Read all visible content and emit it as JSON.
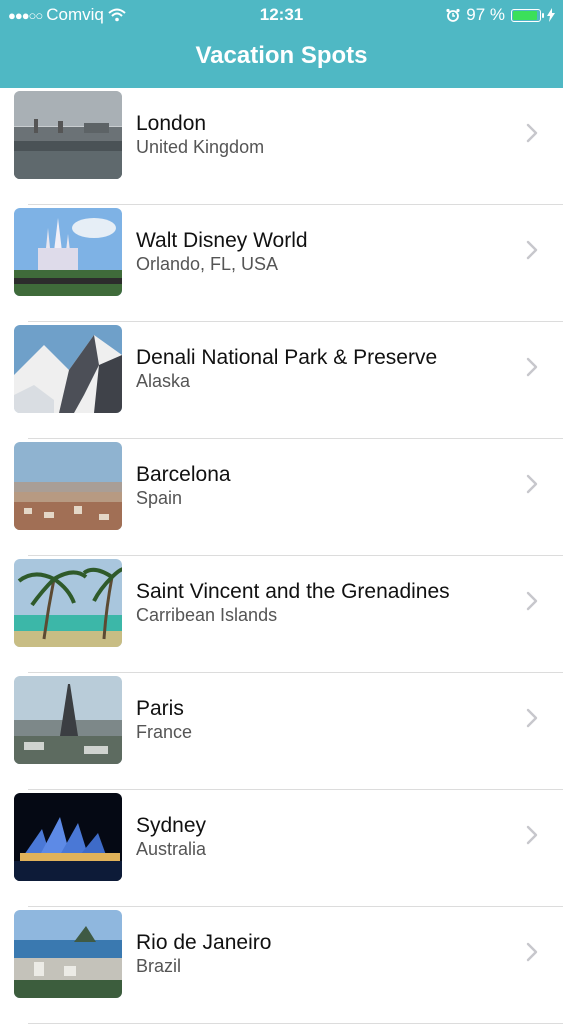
{
  "status_bar": {
    "carrier": "Comviq",
    "time": "12:31",
    "battery_percent": "97 %",
    "battery_level": 0.97
  },
  "nav": {
    "title": "Vacation Spots"
  },
  "colors": {
    "accent": "#4fb8c4"
  },
  "spots": [
    {
      "title": "London",
      "subtitle": "United Kingdom",
      "image": "london-photo"
    },
    {
      "title": "Walt Disney World",
      "subtitle": "Orlando, FL, USA",
      "image": "disney-castle-photo"
    },
    {
      "title": "Denali National Park & Preserve",
      "subtitle": "Alaska",
      "image": "mountains-photo"
    },
    {
      "title": "Barcelona",
      "subtitle": "Spain",
      "image": "city-skyline-photo"
    },
    {
      "title": "Saint Vincent and the Grenadines",
      "subtitle": "Carribean Islands",
      "image": "beach-palms-photo"
    },
    {
      "title": "Paris",
      "subtitle": "France",
      "image": "eiffel-tower-photo"
    },
    {
      "title": "Sydney",
      "subtitle": "Australia",
      "image": "opera-house-photo"
    },
    {
      "title": "Rio de Janeiro",
      "subtitle": "Brazil",
      "image": "bay-city-photo"
    }
  ]
}
